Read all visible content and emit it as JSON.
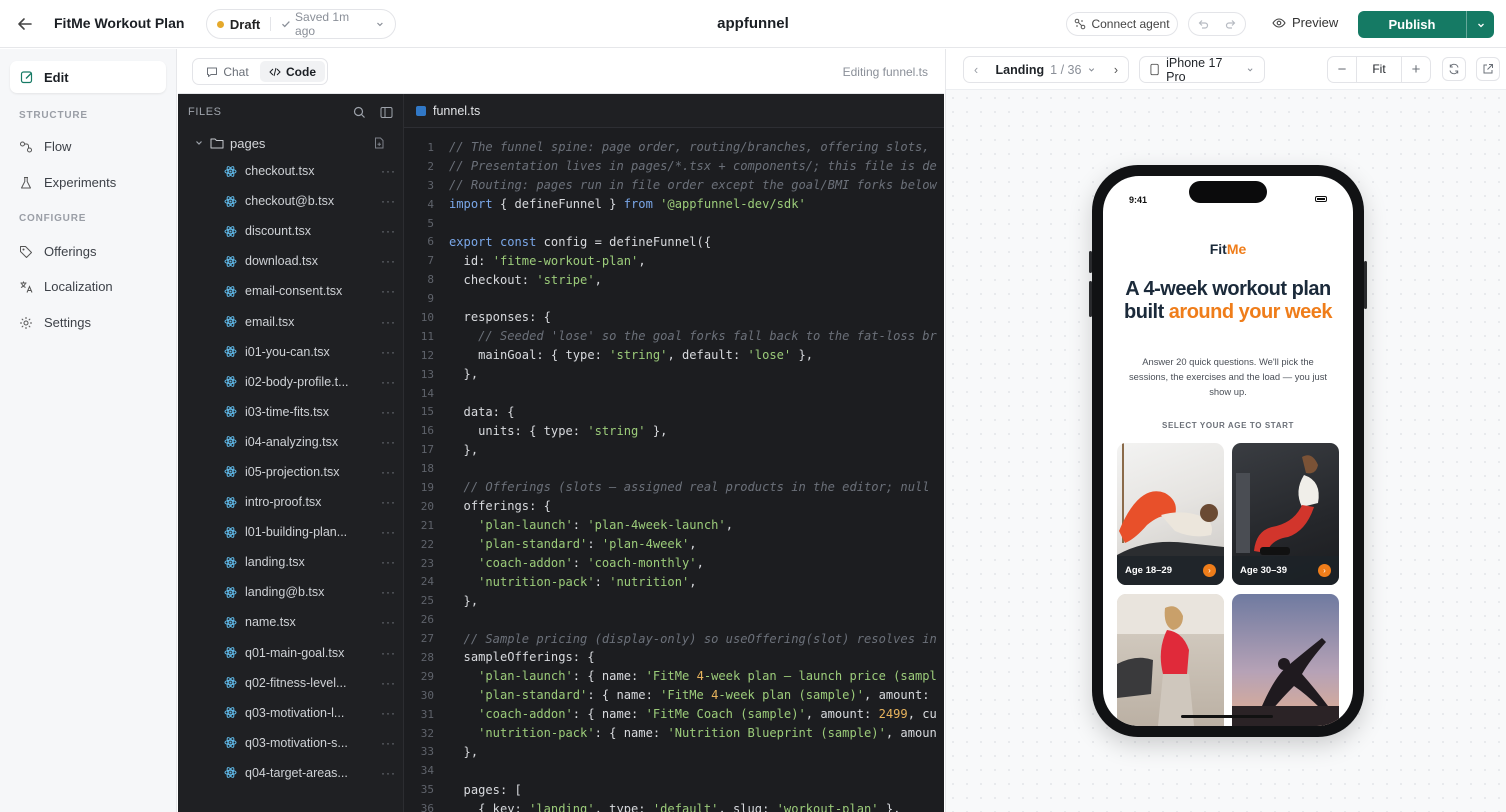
{
  "topbar": {
    "project_title": "FitMe Workout Plan",
    "status": "Draft",
    "saved": "Saved 1m ago",
    "brand": "appfunnel",
    "connect_agent": "Connect agent",
    "preview": "Preview",
    "publish": "Publish"
  },
  "sidebar": {
    "edit": "Edit",
    "section_structure": "STRUCTURE",
    "flow": "Flow",
    "experiments": "Experiments",
    "section_configure": "CONFIGURE",
    "offerings": "Offerings",
    "localization": "Localization",
    "settings": "Settings"
  },
  "panel": {
    "tab_chat": "Chat",
    "tab_code": "Code",
    "editing": "Editing funnel.ts"
  },
  "files": {
    "header": "FILES",
    "folder": "pages",
    "items": [
      "checkout.tsx",
      "checkout@b.tsx",
      "discount.tsx",
      "download.tsx",
      "email-consent.tsx",
      "email.tsx",
      "i01-you-can.tsx",
      "i02-body-profile.t...",
      "i03-time-fits.tsx",
      "i04-analyzing.tsx",
      "i05-projection.tsx",
      "intro-proof.tsx",
      "l01-building-plan...",
      "landing.tsx",
      "landing@b.tsx",
      "name.tsx",
      "q01-main-goal.tsx",
      "q02-fitness-level...",
      "q03-motivation-l...",
      "q03-motivation-s...",
      "q04-target-areas..."
    ]
  },
  "code": {
    "tab": "funnel.ts",
    "lines": [
      "// The funnel spine: page order, routing/branches, offering slots,",
      "// Presentation lives in pages/*.tsx + components/; this file is de",
      "// Routing: pages run in file order except the goal/BMI forks below",
      "import { defineFunnel } from '@appfunnel-dev/sdk'",
      "",
      "export const config = defineFunnel({",
      "  id: 'fitme-workout-plan',",
      "  checkout: 'stripe',",
      "",
      "  responses: {",
      "    // Seeded 'lose' so the goal forks fall back to the fat-loss br",
      "    mainGoal: { type: 'string', default: 'lose' },",
      "  },",
      "",
      "  data: {",
      "    units: { type: 'string' },",
      "  },",
      "",
      "  // Offerings (slots — assigned real products in the editor; null",
      "  offerings: {",
      "    'plan-launch': 'plan-4week-launch',",
      "    'plan-standard': 'plan-4week',",
      "    'coach-addon': 'coach-monthly',",
      "    'nutrition-pack': 'nutrition',",
      "  },",
      "",
      "  // Sample pricing (display-only) so useOffering(slot) resolves in",
      "  sampleOfferings: {",
      "    'plan-launch': { name: 'FitMe 4-week plan — launch price (sampl",
      "    'plan-standard': { name: 'FitMe 4-week plan (sample)', amount:",
      "    'coach-addon': { name: 'FitMe Coach (sample)', amount: 2499, cu",
      "    'nutrition-pack': { name: 'Nutrition Blueprint (sample)', amoun",
      "  },",
      "",
      "  pages: [",
      "    { key: 'landing', type: 'default', slug: 'workout-plan' },"
    ]
  },
  "preview": {
    "page_name": "Landing",
    "page_count": "1 / 36",
    "device": "iPhone 17 Pro",
    "zoom": "Fit"
  },
  "phone": {
    "time": "9:41",
    "logo_fit": "Fit",
    "logo_me": "Me",
    "headline_a": "A 4-week workout plan built ",
    "headline_b": "around your week",
    "subtitle": "Answer 20 quick questions. We'll pick the sessions, the exercises and the load — you just show up.",
    "cta": "SELECT YOUR AGE TO START",
    "cards": [
      "Age 18–29",
      "Age 30–39"
    ]
  },
  "colors": {
    "publish": "#157a64",
    "accent": "#ef7d1a",
    "draft_dot": "#e5a92b"
  }
}
